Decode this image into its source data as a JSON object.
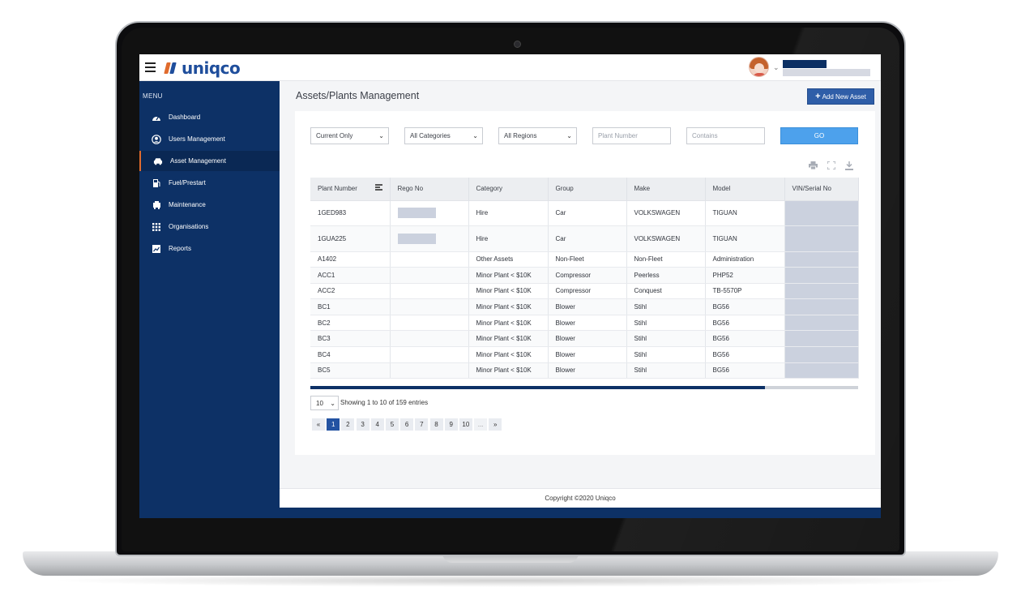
{
  "header": {
    "logo_text": "uniqco",
    "brand_colors": {
      "primary": "#1f4e9c",
      "accent": "#e06b2d",
      "sidebar": "#0d3166"
    }
  },
  "sidebar": {
    "menu_title": "MENU",
    "items": [
      {
        "label": "Dashboard",
        "icon": "dashboard-gauge-icon"
      },
      {
        "label": "Users Management",
        "icon": "user-circle-icon"
      },
      {
        "label": "Asset Management",
        "icon": "car-icon",
        "active": true
      },
      {
        "label": "Fuel/Prestart",
        "icon": "fuel-pump-icon"
      },
      {
        "label": "Maintenance",
        "icon": "service-icon"
      },
      {
        "label": "Organisations",
        "icon": "grid-icon"
      },
      {
        "label": "Reports",
        "icon": "report-chart-icon"
      }
    ]
  },
  "main": {
    "page_title": "Assets/Plants Management",
    "add_button": "Add New Asset",
    "filters": {
      "status": "Current Only",
      "category": "All Categories",
      "region": "All Regions",
      "plant_number_placeholder": "Plant Number",
      "contains_placeholder": "Contains",
      "go_label": "GO"
    },
    "table": {
      "columns": [
        "Plant Number",
        "Rego No",
        "Category",
        "Group",
        "Make",
        "Model",
        "VIN/Serial No"
      ],
      "rows": [
        [
          "1GED983",
          "",
          "Hire",
          "Car",
          "VOLKSWAGEN",
          "TIGUAN",
          ""
        ],
        [
          "1GUA225",
          "",
          "Hire",
          "Car",
          "VOLKSWAGEN",
          "TIGUAN",
          ""
        ],
        [
          "A1402",
          "",
          "Other Assets",
          "Non-Fleet",
          "Non-Fleet",
          "Administration",
          ""
        ],
        [
          "ACC1",
          "",
          "Minor Plant < $10K",
          "Compressor",
          "Peerless",
          "PHP52",
          ""
        ],
        [
          "ACC2",
          "",
          "Minor Plant < $10K",
          "Compressor",
          "Conquest",
          "TB-5570P",
          ""
        ],
        [
          "BC1",
          "",
          "Minor Plant < $10K",
          "Blower",
          "Stihl",
          "BG56",
          ""
        ],
        [
          "BC2",
          "",
          "Minor Plant < $10K",
          "Blower",
          "Stihl",
          "BG56",
          ""
        ],
        [
          "BC3",
          "",
          "Minor Plant < $10K",
          "Blower",
          "Stihl",
          "BG56",
          ""
        ],
        [
          "BC4",
          "",
          "Minor Plant < $10K",
          "Blower",
          "Stihl",
          "BG56",
          ""
        ],
        [
          "BC5",
          "",
          "Minor Plant < $10K",
          "Blower",
          "Stihl",
          "BG56",
          ""
        ]
      ],
      "horizontal_scroll_fraction": 0.83
    },
    "page_length": "10",
    "info_text": "Showing 1 to 10 of 159 entries",
    "pagination": [
      "«",
      "1",
      "2",
      "3",
      "4",
      "5",
      "6",
      "7",
      "8",
      "9",
      "10",
      "...",
      "»"
    ],
    "current_page": "1"
  },
  "footer": {
    "copyright": "Copyright ©2020 Uniqco"
  }
}
